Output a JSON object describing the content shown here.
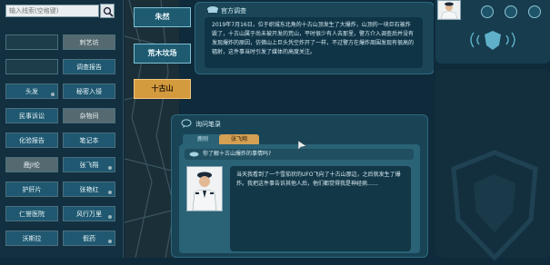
{
  "search": {
    "placeholder": "输入线索(空格键)"
  },
  "sidebar": {
    "rows": [
      {
        "left": "",
        "right": "刺艺坊"
      },
      {
        "left": "",
        "right": "调查报告"
      },
      {
        "left": "头发",
        "right": "秘密入侵"
      },
      {
        "left": "民事诉讼",
        "right": "杂物间"
      },
      {
        "left": "化验报告",
        "right": "笔记本"
      },
      {
        "left": "鹿JI伦",
        "right": "张飞翔"
      },
      {
        "left": "护肝片",
        "right": "张艳红"
      },
      {
        "left": "仁誉医院",
        "right": "风行万里"
      },
      {
        "left": "沃斯拉",
        "right": "假药"
      }
    ]
  },
  "map": {
    "locations": [
      {
        "label": "朱然",
        "active": false
      },
      {
        "label": "荒木坟场",
        "active": false
      },
      {
        "label": "十古山",
        "active": true
      }
    ]
  },
  "report": {
    "title": "官方调查",
    "body": "2019年7月16日，位于织城东北角的十古山顶发生了大爆炸，山顶的一块巨石被炸毁了，十古山属于尚未被开发的荒山，平时很少有人去那里，警方介入调查后并没有发现爆炸的原因，仿佛山上巨头凭空炸开了一样，不过警方在爆炸周围发现有很高的辐射，这件事当时引发了媒体的高度关注。"
  },
  "interrogation": {
    "title": "询问笔录",
    "tabs": [
      "鹿刚",
      "张飞翔"
    ],
    "question": "你了解十古山爆炸的事情吗?",
    "answer": "当天我看到了一个雪茄状的UFO飞向了十古山那边，之后就发生了爆炸。我把这件事告诉其他人后，他们都觉得我是神经病……"
  },
  "colors": {
    "accent_gold": "#d49a3e",
    "panel_teal": "#1a4658",
    "background": "#0f2a3a"
  }
}
